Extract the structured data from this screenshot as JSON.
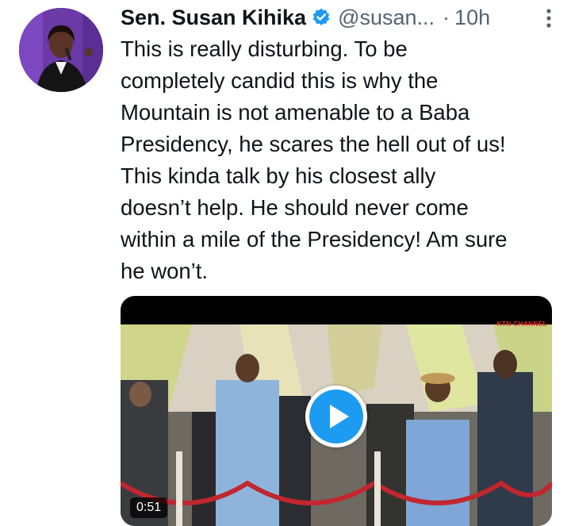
{
  "tweet": {
    "author": {
      "display_name": "Sen. Susan Kihika",
      "handle": "@susan...",
      "verified": true
    },
    "separator": "·",
    "timestamp": "10h",
    "text_lines": [
      "This is really disturbing. To be",
      "completely candid this is why the",
      "Mountain is not amenable to a Baba",
      "Presidency, he scares the hell out of us!",
      "This kinda talk by his closest ally",
      "doesn’t help. He should never come",
      "within a mile of the Presidency! Am sure",
      "he won’t."
    ],
    "media": {
      "type": "video",
      "duration": "0:51",
      "watermark": "KTN CHANNEL"
    }
  },
  "colors": {
    "verified_badge": "#1d9bf0",
    "play_button": "#1d9bf0",
    "secondary_text": "#536471"
  },
  "icons": {
    "verified": "verified-badge-icon",
    "more": "more-options-icon",
    "play": "play-icon"
  }
}
